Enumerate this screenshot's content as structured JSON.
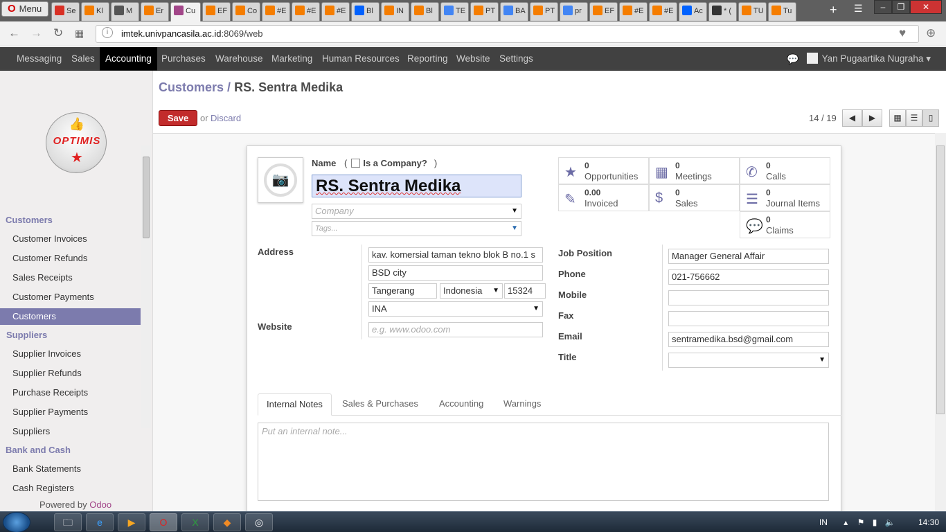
{
  "browser": {
    "menu_label": "Menu",
    "tabs": [
      {
        "label": "Se",
        "icon": "gmail-icon",
        "color": "#d93025"
      },
      {
        "label": "Kl",
        "icon": "blogger-icon",
        "color": "#f57d00"
      },
      {
        "label": "M",
        "icon": "book-icon",
        "color": "#555555"
      },
      {
        "label": "Er",
        "icon": "blogger-icon",
        "color": "#f57d00"
      },
      {
        "label": "Cu",
        "icon": "odoo-icon",
        "color": "#a24689"
      },
      {
        "label": "EF",
        "icon": "blogger-icon",
        "color": "#f57d00"
      },
      {
        "label": "Co",
        "icon": "blogger-icon",
        "color": "#f57d00"
      },
      {
        "label": "#E",
        "icon": "blogger-icon",
        "color": "#f57d00"
      },
      {
        "label": "#E",
        "icon": "blogger-icon",
        "color": "#f57d00"
      },
      {
        "label": "#E",
        "icon": "blogger-icon",
        "color": "#f57d00"
      },
      {
        "label": "Bl",
        "icon": "dropbox-icon",
        "color": "#0061fe"
      },
      {
        "label": "IN",
        "icon": "blogger-icon",
        "color": "#f57d00"
      },
      {
        "label": "Bl",
        "icon": "blogger-icon",
        "color": "#f57d00"
      },
      {
        "label": "TE",
        "icon": "google-icon",
        "color": "#4285f4"
      },
      {
        "label": "PT",
        "icon": "blogger-icon",
        "color": "#f57d00"
      },
      {
        "label": "BA",
        "icon": "google-icon",
        "color": "#4285f4"
      },
      {
        "label": "PT",
        "icon": "blogger-icon",
        "color": "#f57d00"
      },
      {
        "label": "pr",
        "icon": "google-icon",
        "color": "#4285f4"
      },
      {
        "label": "EF",
        "icon": "blogger-icon",
        "color": "#f57d00"
      },
      {
        "label": "#E",
        "icon": "blogger-icon",
        "color": "#f57d00"
      },
      {
        "label": "#E",
        "icon": "blogger-icon",
        "color": "#f57d00"
      },
      {
        "label": "Ac",
        "icon": "dropbox-icon",
        "color": "#0061fe"
      },
      {
        "label": "* (",
        "icon": "hash-icon",
        "color": "#333333"
      },
      {
        "label": "TU",
        "icon": "blogger-icon",
        "color": "#f57d00"
      },
      {
        "label": "Tu",
        "icon": "blogger-icon",
        "color": "#f57d00"
      }
    ],
    "url_domain": "imtek.univpancasila.ac.id",
    "url_rest": ":8069/web"
  },
  "topmenu": {
    "items": [
      "Messaging",
      "Sales",
      "Accounting",
      "Purchases",
      "Warehouse",
      "Marketing",
      "Human Resources",
      "Reporting",
      "Website",
      "Settings"
    ],
    "active": "Accounting",
    "user": "Yan Pugaartika Nugraha"
  },
  "sidebar": {
    "logo_text": "OPTIMIS",
    "sections": [
      {
        "title": "Customers",
        "items": [
          "Customer Invoices",
          "Customer Refunds",
          "Sales Receipts",
          "Customer Payments",
          "Customers"
        ]
      },
      {
        "title": "Suppliers",
        "items": [
          "Supplier Invoices",
          "Supplier Refunds",
          "Purchase Receipts",
          "Supplier Payments",
          "Suppliers"
        ]
      },
      {
        "title": "Bank and Cash",
        "items": [
          "Bank Statements",
          "Cash Registers"
        ]
      }
    ],
    "active_item": "Customers",
    "powered_by": "Powered by",
    "powered_brand": "Odoo"
  },
  "header": {
    "breadcrumb_parent": "Customers",
    "breadcrumb_sep": "/",
    "breadcrumb_current": "RS. Sentra Medika",
    "save_label": "Save",
    "or_label": "or",
    "discard_label": "Discard",
    "pager": "14 / 19"
  },
  "form": {
    "name_label": "Name",
    "is_company_label": "Is a Company?",
    "is_company_open": "(",
    "is_company_close": ")",
    "name_value": "RS. Sentra Medika",
    "company_placeholder": "Company",
    "tags_placeholder": "Tags...",
    "address_label": "Address",
    "street": "kav. komersial taman tekno blok B no.1 s",
    "street2": "BSD city",
    "city": "Tangerang",
    "country": "Indonesia",
    "zip": "15324",
    "state": "INA",
    "website_label": "Website",
    "website_placeholder": "e.g. www.odoo.com",
    "job_position_label": "Job Position",
    "job_position": "Manager General Affair",
    "phone_label": "Phone",
    "phone": "021-756662",
    "mobile_label": "Mobile",
    "mobile": "",
    "fax_label": "Fax",
    "fax": "",
    "email_label": "Email",
    "email": "sentramedika.bsd@gmail.com",
    "title_label": "Title",
    "title": ""
  },
  "stats": [
    {
      "value": "0",
      "label": "Opportunities",
      "icon": "star-icon"
    },
    {
      "value": "0",
      "label": "Meetings",
      "icon": "calendar-icon"
    },
    {
      "value": "0",
      "label": "Calls",
      "icon": "phone-icon"
    },
    {
      "value": "0.00",
      "label": "Invoiced",
      "icon": "edit-icon"
    },
    {
      "value": "0",
      "label": "Sales",
      "icon": "dollar-icon"
    },
    {
      "value": "0",
      "label": "Journal Items",
      "icon": "list-icon"
    },
    {
      "value": "0",
      "label": "Claims",
      "icon": "comments-icon"
    }
  ],
  "notebook": {
    "tabs": [
      "Internal Notes",
      "Sales & Purchases",
      "Accounting",
      "Warnings"
    ],
    "active": "Internal Notes",
    "notes_placeholder": "Put an internal note..."
  },
  "taskbar": {
    "lang": "IN",
    "time": "14:30"
  }
}
